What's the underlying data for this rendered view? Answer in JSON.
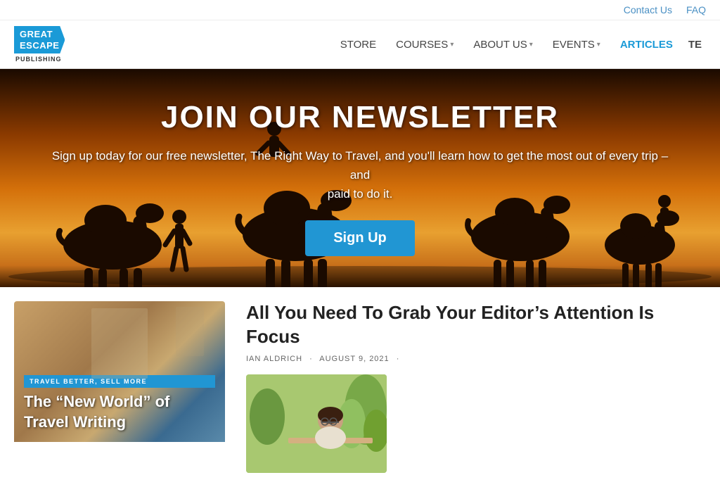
{
  "topbar": {
    "contact_label": "Contact Us",
    "faq_label": "FAQ"
  },
  "header": {
    "logo": {
      "line1": "GREAT",
      "line2": "ESCAPE",
      "publishing": "PUBLISHING"
    },
    "nav": [
      {
        "label": "STORE",
        "has_dropdown": false,
        "active": false
      },
      {
        "label": "COURSES",
        "has_dropdown": true,
        "active": false
      },
      {
        "label": "ABOUT US",
        "has_dropdown": true,
        "active": false
      },
      {
        "label": "EVENTS",
        "has_dropdown": true,
        "active": false
      },
      {
        "label": "ARTICLES",
        "has_dropdown": false,
        "active": true
      },
      {
        "label": "TE",
        "has_dropdown": false,
        "active": false
      }
    ]
  },
  "hero": {
    "title": "JOIN OUR NEWSLETTER",
    "subtitle": "Sign up today for our free newsletter, The Right Way to Travel, and you'll learn how to get the most out of every trip – and",
    "subtitle2": "paid to do it.",
    "signup_label": "Sign Up"
  },
  "article_card": {
    "badge": "TRAVEL BETTER, SELL MORE",
    "title": "The “New World” of Travel Writing"
  },
  "article_main": {
    "title": "All You Need To Grab Your Editor’s Attention Is Focus",
    "author": "IAN ALDRICH",
    "separator": "·",
    "date": "AUGUST 9, 2021",
    "dot": "·"
  }
}
